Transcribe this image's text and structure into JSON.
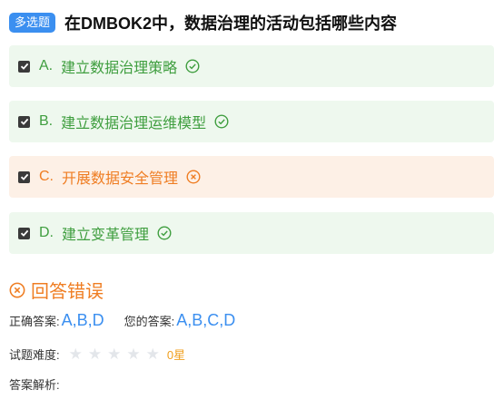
{
  "question": {
    "type_badge": "多选题",
    "title": "在DMBOK2中，数据治理的活动包括哪些内容"
  },
  "options": [
    {
      "letter": "A.",
      "text": "建立数据治理策略",
      "checked": true,
      "status": "correct"
    },
    {
      "letter": "B.",
      "text": "建立数据治理运维模型",
      "checked": true,
      "status": "correct"
    },
    {
      "letter": "C.",
      "text": "开展数据安全管理",
      "checked": true,
      "status": "wrong"
    },
    {
      "letter": "D.",
      "text": "建立变革管理",
      "checked": true,
      "status": "correct"
    }
  ],
  "result": {
    "text": "回答错误",
    "icon": "circle-x-icon"
  },
  "answers": {
    "correct_label": "正确答案:",
    "correct_value": "A,B,D",
    "yours_label": "您的答案:",
    "yours_value": "A,B,C,D"
  },
  "difficulty": {
    "label": "试题难度:",
    "stars_total": 5,
    "stars_filled": 0,
    "stars_text": "0星"
  },
  "analysis": {
    "label": "答案解析:"
  },
  "colors": {
    "correct": "#3f9e3f",
    "correct_bg": "#eef8ee",
    "wrong": "#ef7d22",
    "wrong_bg": "#fdf0e6",
    "accent": "#3b8ff0"
  }
}
